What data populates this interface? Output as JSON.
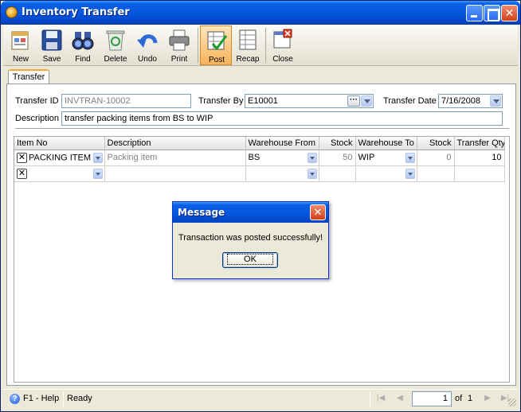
{
  "window": {
    "title": "Inventory Transfer",
    "colors": {
      "titlebar": "#0558e0",
      "accent_active_tool": "#f7b25a"
    }
  },
  "toolbar": {
    "buttons": [
      {
        "label": "New",
        "icon": "new-document-icon"
      },
      {
        "label": "Save",
        "icon": "floppy-disk-icon"
      },
      {
        "label": "Find",
        "icon": "binoculars-icon"
      },
      {
        "label": "Delete",
        "icon": "recycle-bin-icon"
      },
      {
        "label": "Undo",
        "icon": "undo-arrow-icon"
      },
      {
        "label": "Print",
        "icon": "printer-icon"
      },
      {
        "label": "Post",
        "icon": "post-check-icon",
        "active": true
      },
      {
        "label": "Recap",
        "icon": "recap-sheet-icon"
      },
      {
        "label": "Close",
        "icon": "close-window-icon"
      }
    ]
  },
  "tabs": [
    {
      "label": "Transfer",
      "active": true
    }
  ],
  "form": {
    "transfer_id_label": "Transfer ID",
    "transfer_id_value": "INVTRAN-10002",
    "transfer_by_label": "Transfer By",
    "transfer_by_value": "E10001",
    "transfer_date_label": "Transfer Date",
    "transfer_date_value": "7/16/2008",
    "description_label": "Description",
    "description_value": "transfer packing items from BS to WIP"
  },
  "grid": {
    "columns": [
      "Item No",
      "Description",
      "Warehouse From",
      "Stock",
      "Warehouse To",
      "Stock",
      "Transfer Qty"
    ],
    "rows": [
      {
        "item_no": "PACKING ITEM",
        "description": "Packing item",
        "warehouse_from": "BS",
        "stock_from": "50",
        "warehouse_to": "WIP",
        "stock_to": "0",
        "transfer_qty": "10"
      },
      {
        "item_no": "",
        "description": "",
        "warehouse_from": "",
        "stock_from": "",
        "warehouse_to": "",
        "stock_to": "",
        "transfer_qty": ""
      }
    ]
  },
  "dialog": {
    "title": "Message",
    "message": "Transaction was posted successfully!",
    "ok_label": "OK"
  },
  "status": {
    "help": "F1 - Help",
    "state": "Ready",
    "page_value": "1",
    "of_label": "of",
    "page_total": "1"
  }
}
